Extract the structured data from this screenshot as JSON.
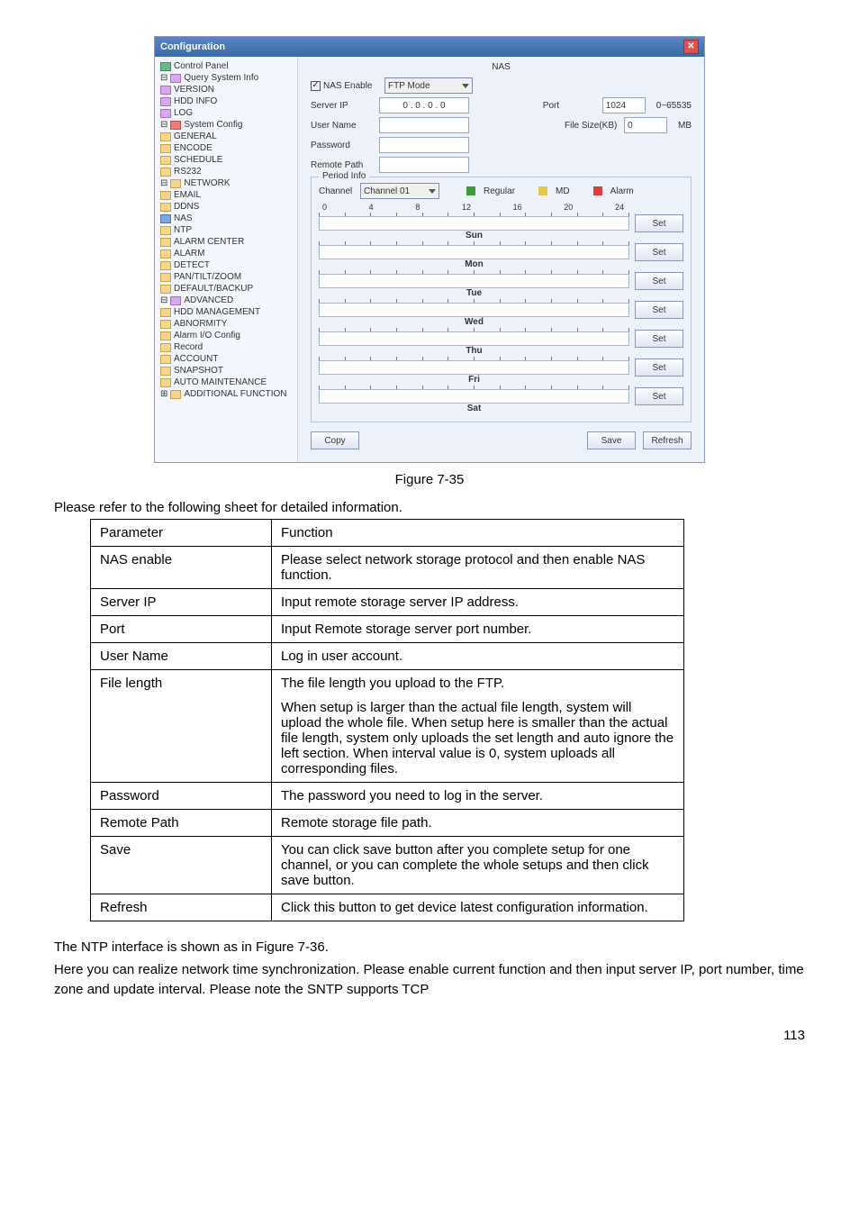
{
  "screenshot": {
    "title": "Configuration",
    "tree": {
      "control_panel": "Control Panel",
      "query": "Query System Info",
      "version": "VERSION",
      "hdd_info": "HDD INFO",
      "log": "LOG",
      "system_config": "System Config",
      "general": "GENERAL",
      "encode": "ENCODE",
      "schedule": "SCHEDULE",
      "rs232": "RS232",
      "network": "NETWORK",
      "email": "EMAIL",
      "ddns": "DDNS",
      "nas": "NAS",
      "ntp": "NTP",
      "alarm_center": "ALARM CENTER",
      "alarm": "ALARM",
      "detect": "DETECT",
      "ptz": "PAN/TILT/ZOOM",
      "default_backup": "DEFAULT/BACKUP",
      "advanced": "ADVANCED",
      "hdd_mgmt": "HDD MANAGEMENT",
      "abnormity": "ABNORMITY",
      "alarm_io": "Alarm I/O Config",
      "record": "Record",
      "account": "ACCOUNT",
      "snapshot": "SNAPSHOT",
      "auto_maint": "AUTO MAINTENANCE",
      "additional": "ADDITIONAL FUNCTION"
    },
    "panel": {
      "header": "NAS",
      "nas_enable": "NAS Enable",
      "ftp_mode": "FTP Mode",
      "server_ip_lbl": "Server IP",
      "server_ip_val": "0 . 0 . 0 . 0",
      "port_lbl": "Port",
      "port_val": "1024",
      "port_range": "0~65535",
      "user_name_lbl": "User Name",
      "file_size_lbl": "File Size(KB)",
      "file_size_val": "0",
      "file_size_unit": "MB",
      "password_lbl": "Password",
      "remote_path_lbl": "Remote Path",
      "period_title": "Period Info",
      "channel_lbl": "Channel",
      "channel_val": "Channel 01",
      "regular": "Regular",
      "md": "MD",
      "alarm": "Alarm",
      "axis": [
        "0",
        "4",
        "8",
        "12",
        "16",
        "20",
        "24"
      ],
      "days": [
        "Sun",
        "Mon",
        "Tue",
        "Wed",
        "Thu",
        "Fri",
        "Sat"
      ],
      "set": "Set",
      "copy": "Copy",
      "save": "Save",
      "refresh": "Refresh"
    }
  },
  "caption": "Figure 7-35",
  "intro": "Please refer to the following sheet for detailed information.",
  "table": {
    "h1": "Parameter",
    "h2": "Function",
    "rows": [
      {
        "p": "NAS enable",
        "f": "Please select network storage protocol and then enable NAS function."
      },
      {
        "p": "Server IP",
        "f": "Input remote storage server IP address."
      },
      {
        "p": "Port",
        "f": "Input Remote storage server port number."
      },
      {
        "p": "User Name",
        "f": "Log in user account."
      },
      {
        "p": "File length",
        "f": "The file length you upload to the FTP.\nWhen setup is larger than the actual file length, system will upload the whole file. When setup here is smaller than the actual file length, system only uploads the set length and auto ignore the left section. When interval value is 0, system uploads all corresponding files."
      },
      {
        "p": "Password",
        "f": "The password you need to log in the server."
      },
      {
        "p": "Remote Path",
        "f": "Remote storage file path."
      },
      {
        "p": "Save",
        "f": "You can click save button after you complete setup for one channel, or you can complete the whole setups and then click save button."
      },
      {
        "p": "Refresh",
        "f": "Click this button to get device latest configuration information."
      }
    ]
  },
  "para1": "The NTP interface is shown as in Figure 7-36.",
  "para2": "Here you can realize network time synchronization. Please enable current function and then input server IP, port number, time zone and update interval. Please note the SNTP supports TCP",
  "pagenum": "113"
}
